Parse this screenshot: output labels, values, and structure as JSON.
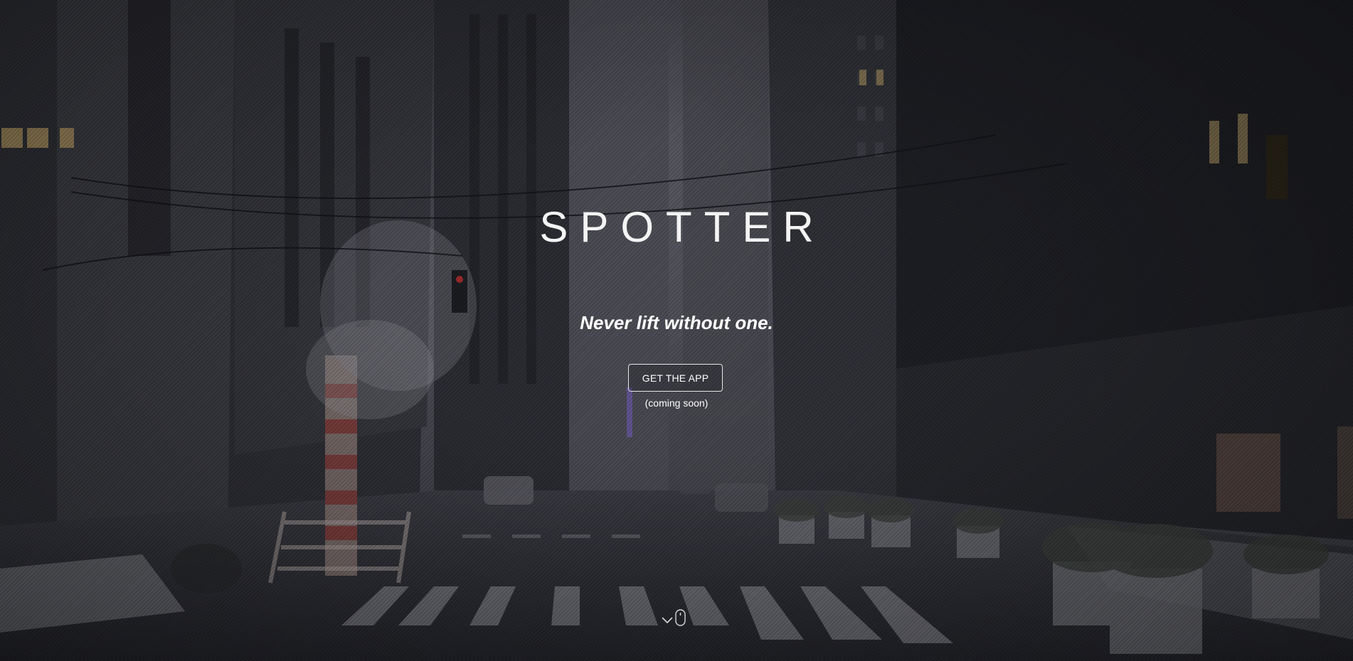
{
  "hero": {
    "brand": "SPOTTER",
    "tagline": "Never lift without one.",
    "cta_label": "GET THE APP",
    "cta_note": "(coming soon)",
    "background_image": "night-city-street-photo",
    "scroll_icon": "chevron-down-mouse-icon"
  },
  "colors": {
    "text": "#ffffff",
    "overlay": "#1b1d22",
    "button_border": "#e6e6e6"
  }
}
